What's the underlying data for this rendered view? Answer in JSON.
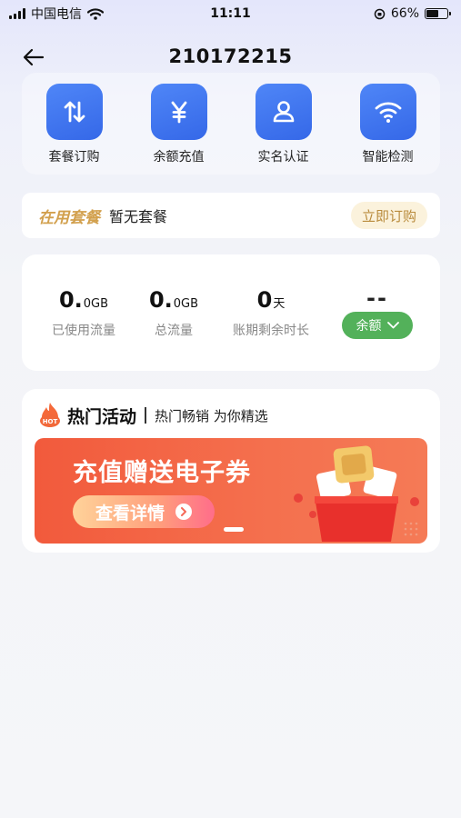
{
  "status_bar": {
    "carrier": "中国电信",
    "time": "11:11",
    "battery_text": "66%",
    "battery_level": 0.66
  },
  "header": {
    "title": "210172215",
    "back_icon": "back-arrow-icon"
  },
  "quick_actions": [
    {
      "label": "套餐订购",
      "icon": "swap-arrows-icon"
    },
    {
      "label": "余额充值",
      "icon": "yuan-icon"
    },
    {
      "label": "实名认证",
      "icon": "user-icon"
    },
    {
      "label": "智能检测",
      "icon": "wifi-icon"
    }
  ],
  "plan": {
    "title": "在用套餐",
    "status": "暂无套餐",
    "button": "立即订购"
  },
  "usage": {
    "used": {
      "value": "0.",
      "unit": "0GB",
      "label": "已使用流量"
    },
    "total": {
      "value": "0.",
      "unit": "0GB",
      "label": "总流量"
    },
    "days": {
      "value": "0",
      "unit": "天",
      "label": "账期剩余时长"
    },
    "balance": {
      "value": "--",
      "button": "余额"
    }
  },
  "promo": {
    "badge": "HOT",
    "title": "热门活动",
    "subtitle": "热门畅销 为你精选",
    "banner": {
      "title": "充值赠送电子券",
      "button": "查看详情"
    }
  },
  "colors": {
    "accent_blue": "#3f73ee",
    "gold": "#d2a04d",
    "green": "#53b15a",
    "banner_red": "#f25a3c"
  }
}
